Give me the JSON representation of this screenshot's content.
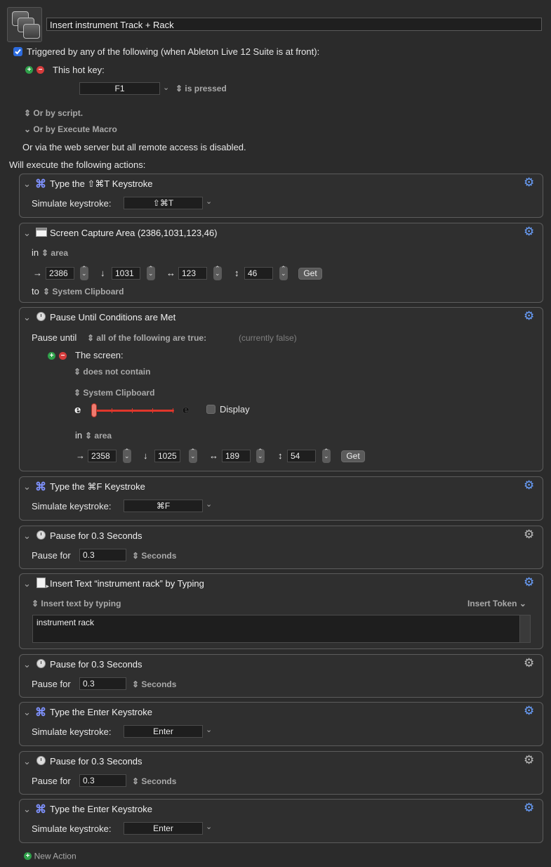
{
  "header": {
    "macro_name": "Insert instrument Track + Rack",
    "trigger_label": "Triggered by any of the following (when Ableton Live 12 Suite is at front):",
    "hotkey_label": "This hot key:",
    "hotkey_value": "F1",
    "hotkey_mode": "is pressed",
    "or_by_script": "Or by script.",
    "or_by_execute_macro": "Or by Execute Macro",
    "web_server_note": "Or via the web server but all remote access is disabled.",
    "will_execute": "Will execute the following actions:"
  },
  "actions": {
    "a1": {
      "title": "Type the ⇧⌘T Keystroke",
      "label": "Simulate keystroke:",
      "value": "⇧⌘T"
    },
    "a2": {
      "title": "Screen Capture Area (2386,1031,123,46)",
      "in_label": "in",
      "area": "area",
      "x": "2386",
      "y": "1031",
      "w": "123",
      "h": "46",
      "get": "Get",
      "to_label": "to",
      "destination": "System Clipboard"
    },
    "a3": {
      "title": "Pause Until Conditions are Met",
      "pause_until": "Pause until",
      "condition_mode": "all of the following are true:",
      "state": "(currently false)",
      "screen_label": "The screen:",
      "contain_mode": "does not contain",
      "source": "System Clipboard",
      "display_label": "Display",
      "slider_left": "e",
      "slider_right": "e",
      "in_label": "in",
      "area": "area",
      "x": "2358",
      "y": "1025",
      "w": "189",
      "h": "54",
      "get": "Get"
    },
    "a4": {
      "title": "Type the ⌘F Keystroke",
      "label": "Simulate keystroke:",
      "value": "⌘F"
    },
    "a5": {
      "title": "Pause for 0.3 Seconds",
      "label": "Pause for",
      "value": "0.3",
      "unit": "Seconds"
    },
    "a6": {
      "title": "Insert Text “instrument rack” by Typing",
      "mode": "Insert text by typing",
      "token": "Insert Token",
      "text": "instrument rack"
    },
    "a7": {
      "title": "Pause for 0.3 Seconds",
      "label": "Pause for",
      "value": "0.3",
      "unit": "Seconds"
    },
    "a8": {
      "title": "Type the Enter Keystroke",
      "label": "Simulate keystroke:",
      "value": "Enter"
    },
    "a9": {
      "title": "Pause for 0.3 Seconds",
      "label": "Pause for",
      "value": "0.3",
      "unit": "Seconds"
    },
    "a10": {
      "title": "Type the Enter Keystroke",
      "label": "Simulate keystroke:",
      "value": "Enter"
    }
  },
  "footer": {
    "new_action": "New Action"
  },
  "icons": {
    "gear": "gear-icon",
    "command": "command-icon",
    "clock": "clock-icon",
    "screen": "screen-capture-icon",
    "text": "insert-text-icon"
  },
  "colors": {
    "accent": "#2d6cdf",
    "plus": "#2fa14a",
    "minus": "#d63c3c",
    "gear_active": "#6aa0ff",
    "slider": "#e0362b"
  }
}
